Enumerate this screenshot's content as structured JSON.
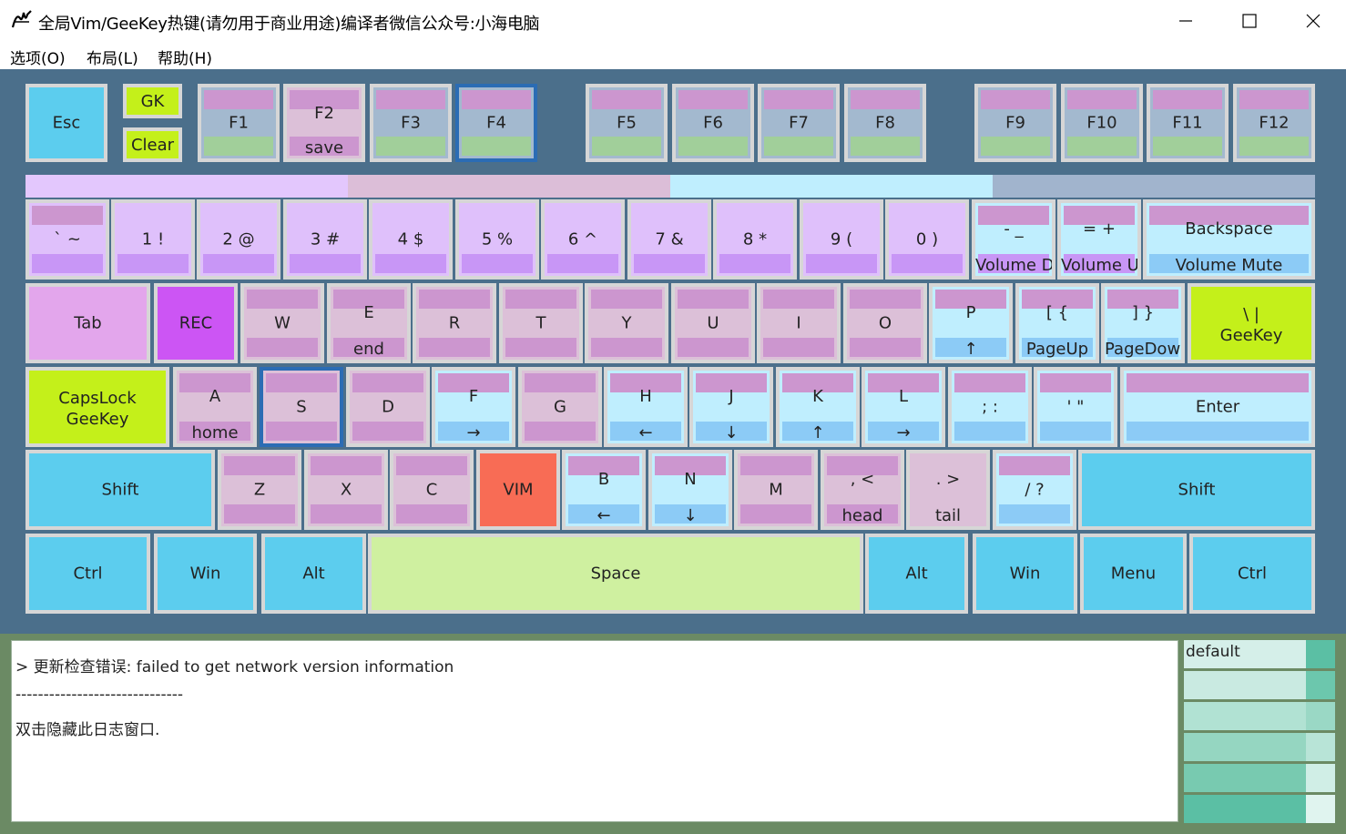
{
  "window": {
    "title": "全局Vim/GeeKey热键(请勿用于商业用途)编译者微信公众号:小海电脑",
    "icon": "app-logo-icon",
    "controls": [
      "minimize-icon",
      "maximize-icon",
      "close-icon"
    ]
  },
  "menu": [
    "选项(O)",
    "布局(L)",
    "帮助(H)"
  ],
  "colors": {
    "keyboard_bg": "#4b6f8b",
    "key_border": "#d6d6d6",
    "selected_border": "#2b6cb4",
    "gk_clear": "#c4f01a",
    "vim_key": "#f86c55",
    "rec_key": "#cc55f4",
    "bottom_bg": "#6b8a64"
  },
  "special_keys": {
    "gk": "GK",
    "clear": "Clear"
  },
  "stripe_colors": [
    "#e3c7fd",
    "#dcbed8",
    "#bfeefe",
    "#a1b4cd"
  ],
  "function_row": [
    {
      "label": "Esc",
      "sub": ""
    },
    {
      "label": "F1",
      "sub": ""
    },
    {
      "label": "F2",
      "sub": "save"
    },
    {
      "label": "F3",
      "sub": ""
    },
    {
      "label": "F4",
      "sub": ""
    },
    {
      "label": "F5",
      "sub": ""
    },
    {
      "label": "F6",
      "sub": ""
    },
    {
      "label": "F7",
      "sub": ""
    },
    {
      "label": "F8",
      "sub": ""
    },
    {
      "label": "F9",
      "sub": ""
    },
    {
      "label": "F10",
      "sub": ""
    },
    {
      "label": "F11",
      "sub": ""
    },
    {
      "label": "F12",
      "sub": ""
    }
  ],
  "number_row": [
    {
      "label": "` ~",
      "sub": ""
    },
    {
      "label": "1 !",
      "sub": ""
    },
    {
      "label": "2 @",
      "sub": ""
    },
    {
      "label": "3 #",
      "sub": ""
    },
    {
      "label": "4 $",
      "sub": ""
    },
    {
      "label": "5 %",
      "sub": ""
    },
    {
      "label": "6 ^",
      "sub": ""
    },
    {
      "label": "7 &",
      "sub": ""
    },
    {
      "label": "8 *",
      "sub": ""
    },
    {
      "label": "9 (",
      "sub": ""
    },
    {
      "label": "0 )",
      "sub": ""
    },
    {
      "label": "- _",
      "sub": "Volume Down"
    },
    {
      "label": "= +",
      "sub": "Volume Up"
    },
    {
      "label": "Backspace",
      "sub": "Volume Mute"
    }
  ],
  "q_row": [
    {
      "label": "Tab",
      "sub": ""
    },
    {
      "label": "REC",
      "sub": ""
    },
    {
      "label": "W",
      "sub": ""
    },
    {
      "label": "E",
      "sub": "end"
    },
    {
      "label": "R",
      "sub": ""
    },
    {
      "label": "T",
      "sub": ""
    },
    {
      "label": "Y",
      "sub": ""
    },
    {
      "label": "U",
      "sub": ""
    },
    {
      "label": "I",
      "sub": ""
    },
    {
      "label": "O",
      "sub": ""
    },
    {
      "label": "P",
      "sub": "↑"
    },
    {
      "label": "[ {",
      "sub": "PageUp"
    },
    {
      "label": "] }",
      "sub": "PageDown"
    },
    {
      "label": "\\ |",
      "sub": "GeeKey"
    }
  ],
  "a_row": [
    {
      "label": "CapsLock",
      "sub": "GeeKey"
    },
    {
      "label": "A",
      "sub": "home"
    },
    {
      "label": "S",
      "sub": ""
    },
    {
      "label": "D",
      "sub": ""
    },
    {
      "label": "F",
      "sub": "→"
    },
    {
      "label": "G",
      "sub": ""
    },
    {
      "label": "H",
      "sub": "←"
    },
    {
      "label": "J",
      "sub": "↓"
    },
    {
      "label": "K",
      "sub": "↑"
    },
    {
      "label": "L",
      "sub": "→"
    },
    {
      "label": "; :",
      "sub": ""
    },
    {
      "label": "' \"",
      "sub": ""
    },
    {
      "label": "Enter",
      "sub": ""
    }
  ],
  "z_row": [
    {
      "label": "Shift",
      "sub": ""
    },
    {
      "label": "Z",
      "sub": ""
    },
    {
      "label": "X",
      "sub": ""
    },
    {
      "label": "C",
      "sub": ""
    },
    {
      "label": "VIM",
      "sub": ""
    },
    {
      "label": "B",
      "sub": "←"
    },
    {
      "label": "N",
      "sub": "↓"
    },
    {
      "label": "M",
      "sub": ""
    },
    {
      "label": ", <",
      "sub": "head"
    },
    {
      "label": ". >",
      "sub": "tail"
    },
    {
      "label": "/ ?",
      "sub": ""
    },
    {
      "label": "Shift",
      "sub": ""
    }
  ],
  "bottom_row": [
    {
      "label": "Ctrl"
    },
    {
      "label": "Win"
    },
    {
      "label": "Alt"
    },
    {
      "label": "Space"
    },
    {
      "label": "Alt"
    },
    {
      "label": "Win"
    },
    {
      "label": "Menu"
    },
    {
      "label": "Ctrl"
    }
  ],
  "log": {
    "lines": [
      "> 更新检查错误: failed to get network version information",
      "------------------------------",
      "双击隐藏此日志窗口."
    ]
  },
  "layouts": {
    "items": [
      "default",
      "",
      "",
      "",
      "",
      ""
    ],
    "colors": [
      {
        "main": "#d5efe9",
        "side": "#5bbfa4"
      },
      {
        "main": "#c9eae1",
        "side": "#6cc7ad"
      },
      {
        "main": "#b1e2d3",
        "side": "#9ad8c5"
      },
      {
        "main": "#95d6c1",
        "side": "#b8e4d7"
      },
      {
        "main": "#78cab0",
        "side": "#d0eee6"
      },
      {
        "main": "#5bbfa4",
        "side": "#e0f4ef"
      }
    ]
  }
}
